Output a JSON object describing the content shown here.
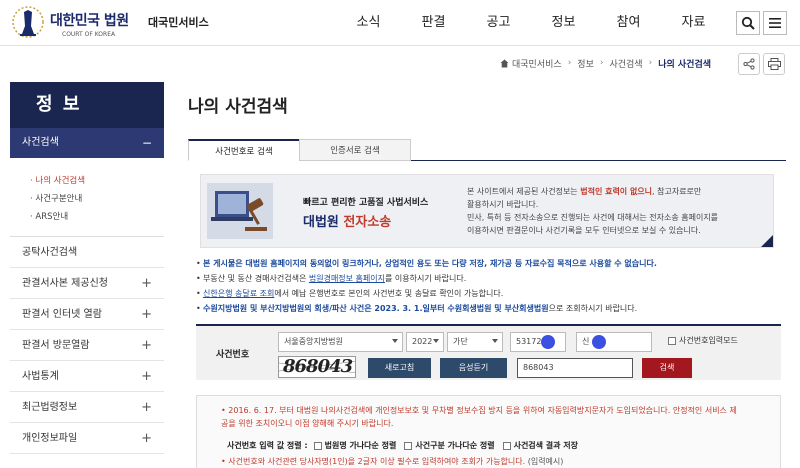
{
  "header": {
    "logo_title": "대한민국 법원",
    "logo_sub": "COURT OF KOREA",
    "site_name": "대국민서비스",
    "nav": [
      "소식",
      "판결",
      "공고",
      "정보",
      "참여",
      "자료"
    ]
  },
  "breadcrumb": {
    "items": [
      "대국민서비스",
      "정보",
      "사건검색"
    ],
    "current": "나의 사건검색"
  },
  "sidebar": {
    "title": "정 보",
    "active_section": "사건검색",
    "active_sign": "−",
    "sub_items": [
      "나의 사건검색",
      "사건구분안내",
      "ARS안내"
    ],
    "items": [
      {
        "label": "공탁사건검색",
        "sign": ""
      },
      {
        "label": "관결서사본 제공신청",
        "sign": "+"
      },
      {
        "label": "판결서 인터넷 열람",
        "sign": "+"
      },
      {
        "label": "판결서 방문열람",
        "sign": "+"
      },
      {
        "label": "사법통계",
        "sign": "+"
      },
      {
        "label": "최근법령정보",
        "sign": "+"
      },
      {
        "label": "개인정보파일",
        "sign": "+"
      }
    ]
  },
  "main": {
    "page_title": "나의 사건검색",
    "tabs": [
      "사건번호로 검색",
      "인증서로 검색"
    ],
    "banner": {
      "head1": "빠르고 편리한 고품질 사법서비스",
      "head2_prefix": "대법원 ",
      "head2_red": "전자소송",
      "text1_a": "본 사이트에서 제공된 사건정보는 ",
      "text1_red": "법적인 효력이 없으니",
      "text1_b": ", 참고자료로만",
      "text2": "활용하시기 바랍니다.",
      "text3": "민사, 특허 등 전자소송으로 진행되는 사건에 대해서는 전자소송 홈페이지를",
      "text4": "이용하시면 판결문이나 사건기록을 모두 인터넷으로 보실 수 있습니다."
    },
    "notices": [
      {
        "bold": "본 게시물은 대법원 홈페이지의 동의없이 링크하거나, 상업적인 용도 또는 다량 저장, 재가공 등 자료수집 목적으로 사용할 수 없습니다."
      },
      {
        "a": "부동산 및 동산 경매사건검색은 ",
        "link": "법원경매정보 홈페이지",
        "b": "를 이용하시기 바랍니다."
      },
      {
        "link": "신한은행 송달료 조회",
        "b": "에서 예납 은행번호로 본인의 사건번호 및 송달료 확인이 가능합니다."
      },
      {
        "bold": "수원지방법원 및 부산지방법원의 회생/파산 사건은 2023. 3. 1.일부터 수원회생법원 및 부산회생법원",
        "b": "으로 조회하시기 바랍니다."
      }
    ],
    "search": {
      "label": "사건번호",
      "court": "서울중앙지방법원",
      "year": "2022",
      "type": "가단",
      "case_number": "531724",
      "party_name": "신",
      "input_mode_label": "사건번호입력모드",
      "captcha_text": "868043",
      "refresh_label": "새로고침",
      "audio_label": "음성듣기",
      "captcha_value": "868043",
      "submit_label": "검색"
    },
    "info": {
      "line1": "2016. 6. 17. 부터 대법원 나의사건검색에 개인정보보호 및 무차별 정보수집 방지 등을 위하여 자동입력방지문자가 도입되었습니다. 안정적인 서비스 제공을 위한 조치이오니 이점 양해해 주시기 바랍니다.",
      "opts_label": "사건번호 입력 값 정렬 :",
      "opts": [
        "법원명 가나다순 정렬",
        "사건구분 가나다순 정렬",
        "사건검색 결과 저장"
      ],
      "line3_a": "사건번호와 사건관련 당사자명(1인)을 2글자 이상 필수로 입력하여야 조회가 가능합니다.",
      "line3_b": " (입력예시)"
    }
  }
}
